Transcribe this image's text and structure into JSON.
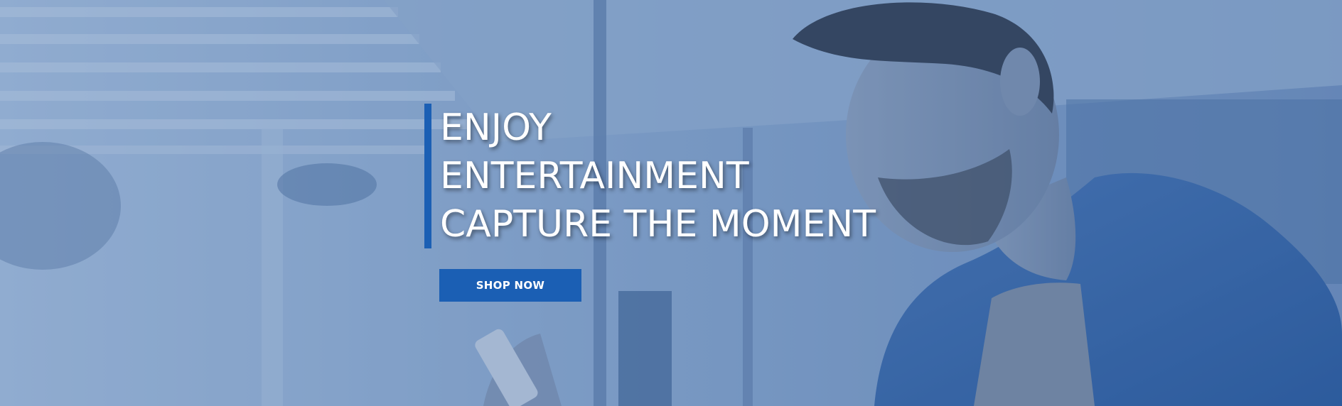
{
  "hero": {
    "headline_lines": [
      "ENJOY",
      "ENTERTAINMENT",
      "CAPTURE THE MOMENT"
    ],
    "cta_label": "SHOP NOW"
  },
  "colors": {
    "accent": "#1b5fb4",
    "text": "#ffffff",
    "overlay": "#285aa0"
  },
  "image": {
    "subject": "man-with-phone-photo"
  }
}
